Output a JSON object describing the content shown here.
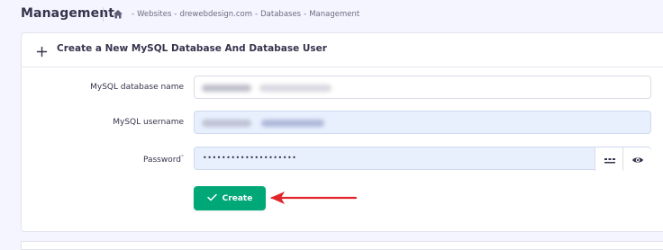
{
  "header": {
    "title": "Management",
    "breadcrumb": [
      "Websites",
      "drewebdesign.com",
      "Databases",
      "Management"
    ],
    "breadcrumb_separator": "-"
  },
  "form": {
    "title": "Create a New MySQL Database And Database User",
    "fields": [
      {
        "label": "MySQL database name",
        "value": ""
      },
      {
        "label": "MySQL username",
        "value": ""
      },
      {
        "label": "Password",
        "value": "••••••••••••••••••••",
        "required_mark": "*"
      }
    ],
    "submit_label": "Create"
  },
  "colors": {
    "accent": "#00a878",
    "arrow": "#e0262b",
    "filled_input": "#e8f0fe"
  },
  "icons": [
    "home-icon",
    "plus-icon",
    "generate-password-icon",
    "eye-icon",
    "check-icon"
  ]
}
